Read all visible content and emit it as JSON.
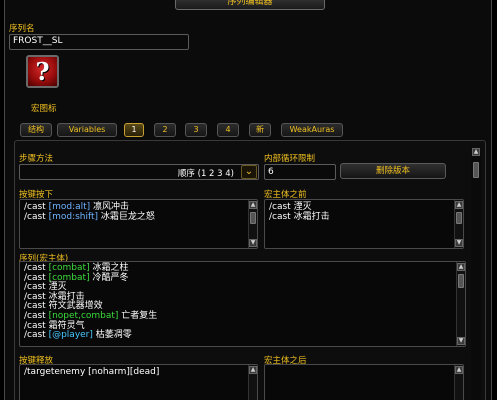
{
  "window": {
    "title": "序列编辑器"
  },
  "sequence_name": {
    "label": "序列名",
    "value": "FROST__SL"
  },
  "macro_icon": {
    "glyph": "?",
    "label": "宏图标",
    "icon": "question-mark-icon"
  },
  "tabs": [
    {
      "label": "结构",
      "active": false
    },
    {
      "label": "Variables",
      "active": false
    },
    {
      "label": "1",
      "active": true
    },
    {
      "label": "2",
      "active": false
    },
    {
      "label": "3",
      "active": false
    },
    {
      "label": "4",
      "active": false
    },
    {
      "label": "新",
      "active": false
    },
    {
      "label": "WeakAuras",
      "active": false
    }
  ],
  "step_method": {
    "label": "步骤方法",
    "value": "顺序 (1 2 3 4)"
  },
  "inner_loop": {
    "label": "内部循环限制",
    "value": "6"
  },
  "delete_version": {
    "label": "删除版本"
  },
  "keypress": {
    "label": "按键按下",
    "lines": [
      [
        {
          "t": "/cast ",
          "c": "white"
        },
        {
          "t": "[mod:alt]",
          "c": "blue"
        },
        {
          "t": " 凛风冲击",
          "c": "white"
        }
      ],
      [
        {
          "t": "/cast ",
          "c": "white"
        },
        {
          "t": "[mod:shift]",
          "c": "blue"
        },
        {
          "t": " 冰霜巨龙之怒",
          "c": "white"
        }
      ]
    ]
  },
  "pre_macro": {
    "label": "宏主体之前",
    "lines": [
      [
        {
          "t": "/cast ",
          "c": "white"
        },
        {
          "t": "湮灭",
          "c": "white"
        }
      ],
      [
        {
          "t": "/cast ",
          "c": "white"
        },
        {
          "t": "冰霜打击",
          "c": "white"
        }
      ]
    ]
  },
  "sequence": {
    "label": "序列(宏主体)",
    "lines": [
      [
        {
          "t": "/cast ",
          "c": "white"
        },
        {
          "t": "[combat]",
          "c": "green"
        },
        {
          "t": " 冰霜之柱",
          "c": "white"
        }
      ],
      [
        {
          "t": "/cast ",
          "c": "white"
        },
        {
          "t": "[combat]",
          "c": "green"
        },
        {
          "t": " 冷酷严冬",
          "c": "white"
        }
      ],
      [
        {
          "t": "/cast ",
          "c": "white"
        },
        {
          "t": "湮灭",
          "c": "white"
        }
      ],
      [
        {
          "t": "/cast ",
          "c": "white"
        },
        {
          "t": "冰霜打击",
          "c": "white"
        }
      ],
      [
        {
          "t": "/cast ",
          "c": "white"
        },
        {
          "t": "符文武器增效",
          "c": "white"
        }
      ],
      [
        {
          "t": "/cast ",
          "c": "white"
        },
        {
          "t": "[nopet,combat]",
          "c": "green"
        },
        {
          "t": " 亡者复生",
          "c": "white"
        }
      ],
      [
        {
          "t": "/cast ",
          "c": "white"
        },
        {
          "t": "霜符灵气",
          "c": "white"
        }
      ],
      [
        {
          "t": "/cast ",
          "c": "white"
        },
        {
          "t": "[@player]",
          "c": "cyan"
        },
        {
          "t": " 枯萎凋零",
          "c": "white"
        }
      ]
    ]
  },
  "keyrelease": {
    "label": "按键释放",
    "lines": [
      [
        {
          "t": "/targetenemy ",
          "c": "white"
        },
        {
          "t": "[noharm][dead]",
          "c": "white"
        }
      ]
    ]
  },
  "post_macro": {
    "label": "宏主体之后",
    "lines": []
  },
  "colors": {
    "label": "#f0c020",
    "accent_border": "#c8a030",
    "keyword_blue": "#6fb4ff",
    "keyword_green": "#3cdc3c",
    "keyword_cyan": "#46c8ff"
  }
}
